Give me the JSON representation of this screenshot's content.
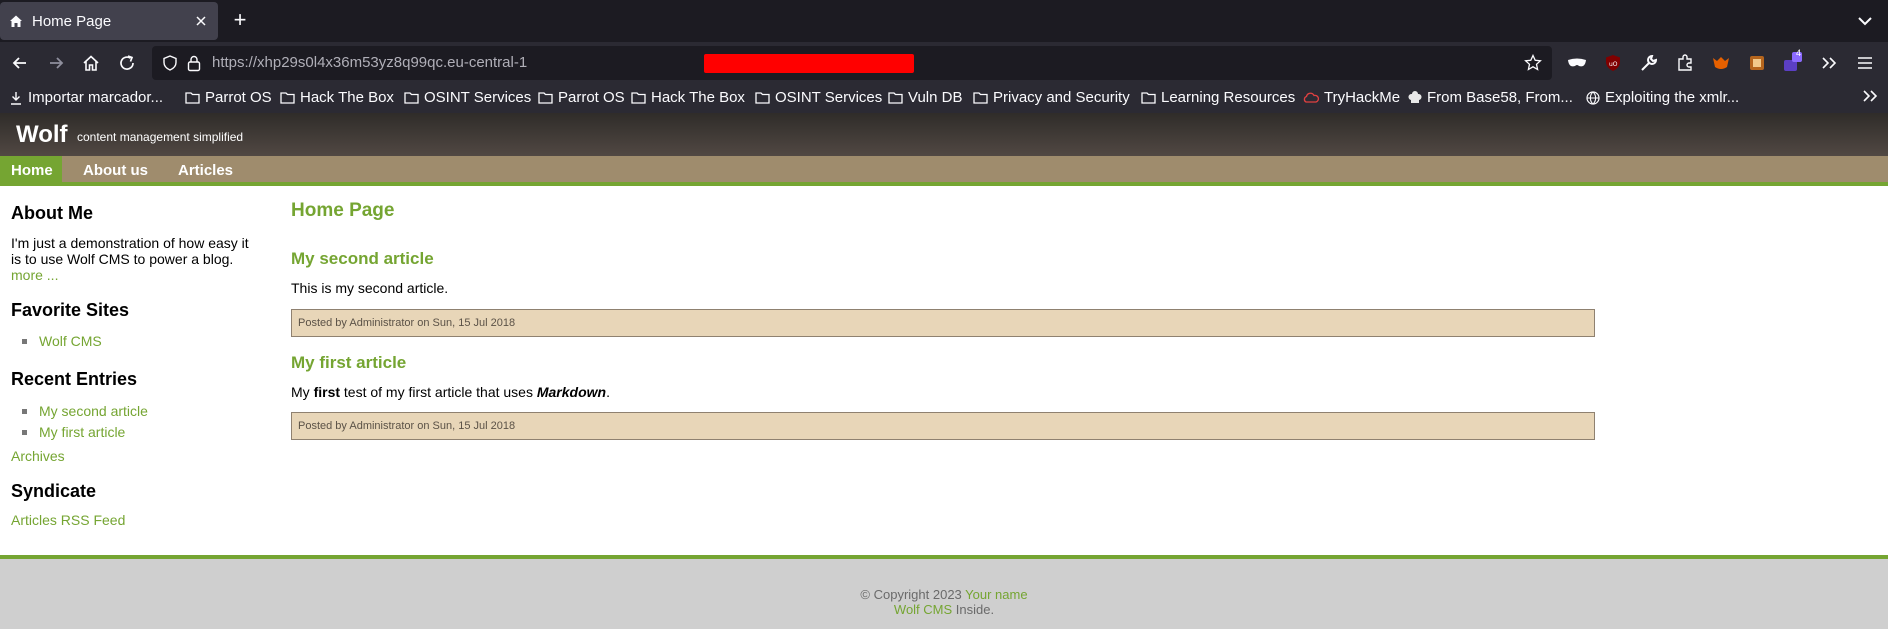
{
  "browser": {
    "tab_title": "Home Page",
    "new_tab_label": "+",
    "url": "https://xhp29s0l4x36m53yz8q99qc.eu-central-1",
    "extension_badge": "4",
    "bookmarks": [
      "Importar marcador...",
      "Parrot OS",
      "Hack The Box",
      "OSINT Services",
      "Parrot OS",
      "Hack The Box",
      "OSINT Services",
      "Vuln DB",
      "Privacy and Security",
      "Learning Resources",
      "TryHackMe",
      "From Base58, From...",
      "Exploiting the xmlr..."
    ]
  },
  "site": {
    "logo": "Wolf",
    "slogan": "content management simplified",
    "menu": [
      "Home",
      "About us",
      "Articles"
    ]
  },
  "sidebar": {
    "about_heading": "About Me",
    "about_line1": "I'm just a demonstration of how easy it",
    "about_line2": "is to use Wolf CMS to power a blog.",
    "more_link": "more ...",
    "favorites_heading": "Favorite Sites",
    "favorites": [
      "Wolf CMS"
    ],
    "recent_heading": "Recent Entries",
    "recent": [
      "My second article",
      "My first article"
    ],
    "archives_link": "Archives",
    "syndicate_heading": "Syndicate",
    "rss_link": "Articles RSS Feed"
  },
  "content": {
    "page_title": "Home Page",
    "articles": [
      {
        "title": "My second article",
        "body": "This is my second article.",
        "info": "Posted by Administrator on Sun, 15 Jul 2018"
      },
      {
        "title": "My first article",
        "body_pre": "My ",
        "body_bold": "first",
        "body_mid": " test of my first article that uses ",
        "body_em": "Markdown",
        "body_post": ".",
        "info": "Posted by Administrator on Sun, 15 Jul 2018"
      }
    ]
  },
  "footer": {
    "copyright": "© Copyright 2023 ",
    "your_name": "Your name",
    "wolf_cms": "Wolf CMS",
    "inside": " Inside."
  },
  "colors": {
    "accent_green": "#75a532",
    "menu_tan": "#9f8c6d",
    "info_bg": "#e8d6b8"
  }
}
